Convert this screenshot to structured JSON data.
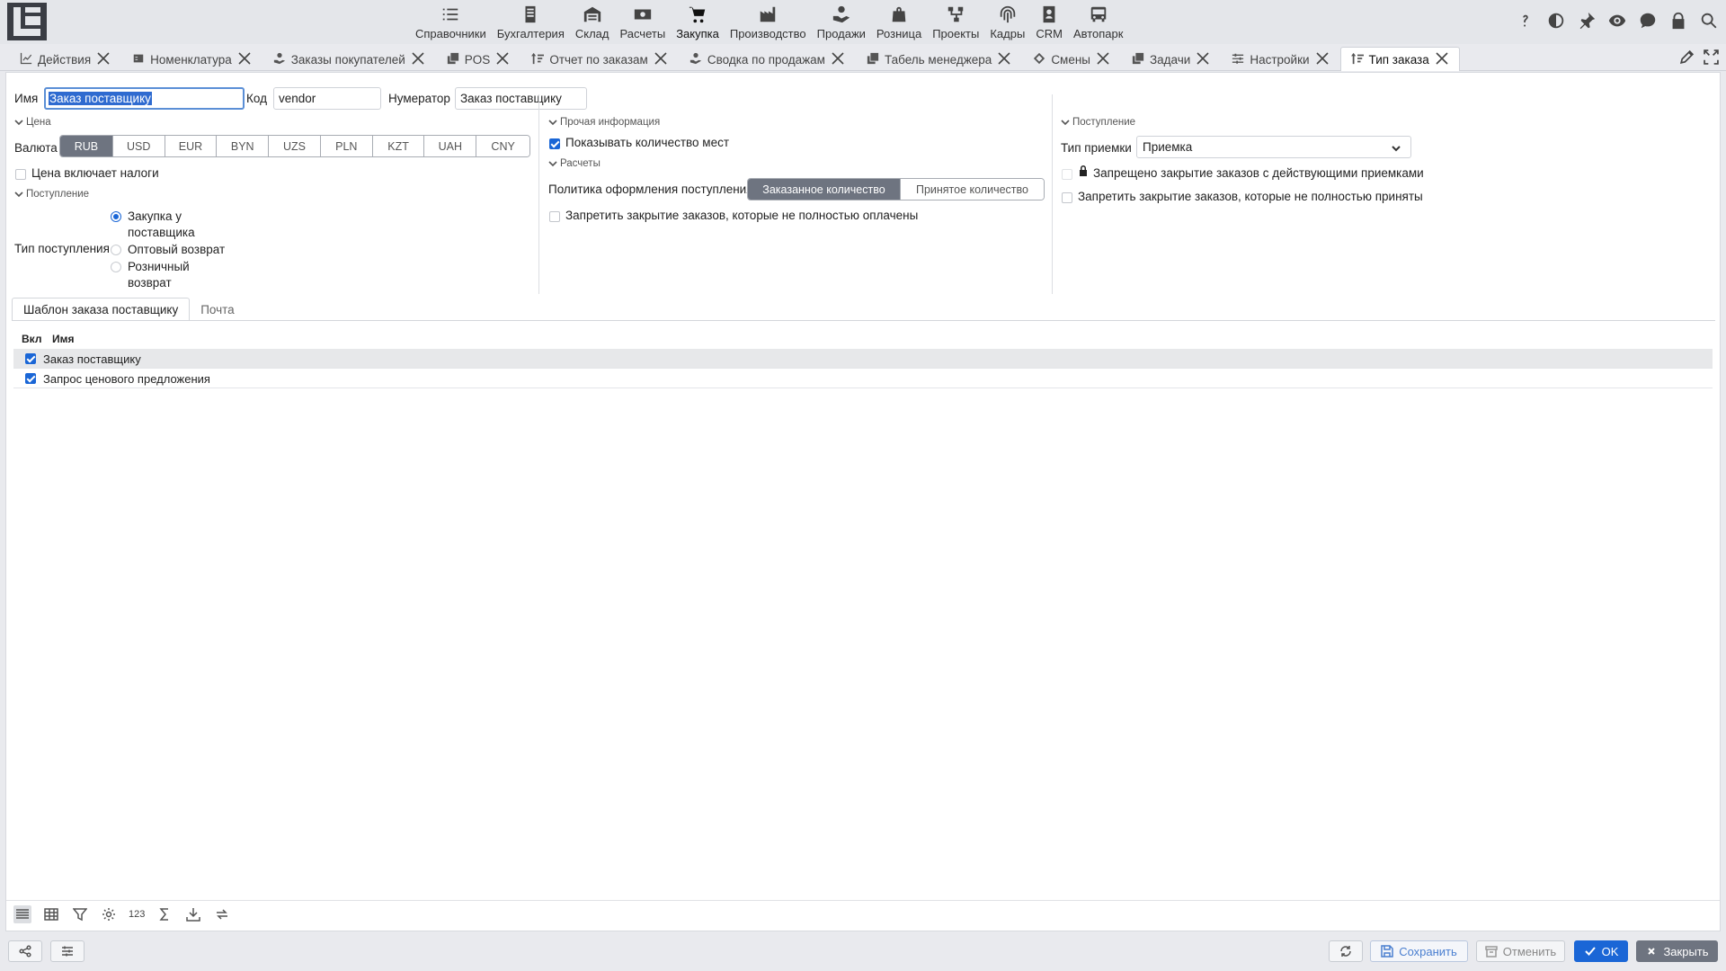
{
  "modules": [
    {
      "label": "Справочники",
      "icon": "list-check-icon"
    },
    {
      "label": "Бухгалтерия",
      "icon": "ledger-icon"
    },
    {
      "label": "Склад",
      "icon": "warehouse-icon"
    },
    {
      "label": "Расчеты",
      "icon": "money-icon"
    },
    {
      "label": "Закупка",
      "icon": "cart-icon"
    },
    {
      "label": "Производство",
      "icon": "factory-icon"
    },
    {
      "label": "Продажи",
      "icon": "hand-coin-icon"
    },
    {
      "label": "Розница",
      "icon": "bag-icon"
    },
    {
      "label": "Проекты",
      "icon": "project-icon"
    },
    {
      "label": "Кадры",
      "icon": "fingerprint-icon"
    },
    {
      "label": "CRM",
      "icon": "contact-icon"
    },
    {
      "label": "Автопарк",
      "icon": "bus-icon"
    }
  ],
  "active_module": "Закупка",
  "tabs": [
    {
      "label": "Действия",
      "icon": "chart-icon"
    },
    {
      "label": "Номенклатура",
      "icon": "catalog-icon"
    },
    {
      "label": "Заказы покупателей",
      "icon": "hand-coin-icon"
    },
    {
      "label": "POS",
      "icon": "copy-icon"
    },
    {
      "label": "Отчет по заказам",
      "icon": "sort-icon"
    },
    {
      "label": "Сводка по продажам",
      "icon": "hand-coin-icon"
    },
    {
      "label": "Табель менеджера",
      "icon": "copy-icon"
    },
    {
      "label": "Смены",
      "icon": "diamond-icon"
    },
    {
      "label": "Задачи",
      "icon": "copy-icon"
    },
    {
      "label": "Настройки",
      "icon": "sliders-icon"
    },
    {
      "label": "Тип заказа",
      "icon": "sort-icon"
    }
  ],
  "form": {
    "name_label": "Имя",
    "name_value": "Заказ поставщику",
    "code_label": "Код",
    "code_value": "vendor",
    "numerator_label": "Нумератор",
    "numerator_value": "Заказ поставщику"
  },
  "price": {
    "section": "Цена",
    "currency_label": "Валюта",
    "currencies": [
      "RUB",
      "USD",
      "EUR",
      "BYN",
      "UZS",
      "PLN",
      "KZT",
      "UAH",
      "CNY"
    ],
    "selected_currency": "RUB",
    "tax_included_label": "Цена включает налоги",
    "tax_included": false
  },
  "receipt_left": {
    "section": "Поступление",
    "type_label": "Тип поступления",
    "options": [
      {
        "line1": "Закупка у",
        "line2": "поставщика",
        "selected": true
      },
      {
        "line1": "Оптовый возврат",
        "line2": "",
        "selected": false
      },
      {
        "line1": "Розничный",
        "line2": "возврат",
        "selected": false
      }
    ]
  },
  "other": {
    "section": "Прочая информация",
    "show_places_label": "Показывать количество мест",
    "show_places": true
  },
  "settlements": {
    "section": "Расчеты",
    "policy_label": "Политика оформления поступления",
    "policy_options": [
      "Заказанное количество",
      "Принятое количество"
    ],
    "policy_selected": "Заказанное количество",
    "forbid_unpaid_label": "Запретить закрытие заказов, которые не полностью оплачены",
    "forbid_unpaid": false
  },
  "receipt_right": {
    "section": "Поступление",
    "acceptance_type_label": "Тип приемки",
    "acceptance_type_value": "Приемка",
    "locked_label": "Запрещено закрытие заказов с действующими приемками",
    "forbid_not_accepted_label": "Запретить закрытие заказов, которые не полностью приняты"
  },
  "inner_tabs": [
    "Шаблон заказа поставщику",
    "Почта"
  ],
  "table": {
    "columns": [
      "Вкл",
      "Имя"
    ],
    "rows": [
      {
        "enabled": true,
        "name": "Заказ поставщику"
      },
      {
        "enabled": true,
        "name": "Запрос ценового предложения"
      }
    ]
  },
  "footer_tools": {
    "numbers_label": "123"
  },
  "buttons": {
    "save": "Сохранить",
    "cancel": "Отменить",
    "ok": "OK",
    "close": "Закрыть"
  }
}
